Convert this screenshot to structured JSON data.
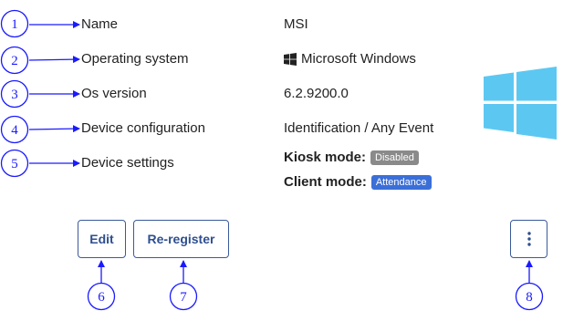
{
  "fields": {
    "name": {
      "label": "Name",
      "value": "MSI"
    },
    "os": {
      "label": "Operating system",
      "value": "Microsoft Windows"
    },
    "os_version": {
      "label": "Os version",
      "value": "6.2.9200.0"
    },
    "device_config": {
      "label": "Device configuration",
      "value": "Identification / Any Event"
    },
    "device_settings": {
      "label": "Device settings"
    }
  },
  "kiosk_mode": {
    "label": "Kiosk mode:",
    "badge": "Disabled",
    "badge_color": "#8a8a8a"
  },
  "client_mode": {
    "label": "Client mode:",
    "badge": "Attendance",
    "badge_color": "#3b6fd8"
  },
  "buttons": {
    "edit": "Edit",
    "reregister": "Re-register",
    "more_icon": "vertical-ellipsis-icon"
  },
  "annotations": [
    "1",
    "2",
    "3",
    "4",
    "5",
    "6",
    "7",
    "8"
  ],
  "colors": {
    "annotation": "#1a1aff",
    "windows_logo": "#5cc8f2",
    "button_text": "#2e4f8f"
  }
}
